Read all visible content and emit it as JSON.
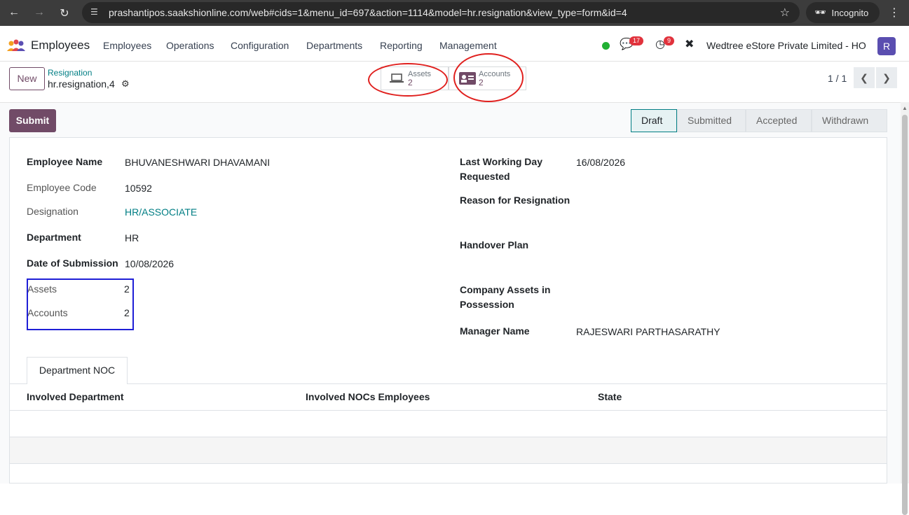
{
  "browser": {
    "url": "prashantipos.saakshionline.com/web#cids=1&menu_id=697&action=1114&model=hr.resignation&view_type=form&id=4",
    "incognito_label": "Incognito"
  },
  "navbar": {
    "app_name": "Employees",
    "menu": [
      "Employees",
      "Operations",
      "Configuration",
      "Departments",
      "Reporting",
      "Management"
    ],
    "messages_badge": "17",
    "activities_badge": "9",
    "company": "Wedtree eStore Private Limited - HO",
    "avatar_letter": "R"
  },
  "control_panel": {
    "new_label": "New",
    "breadcrumb_parent": "Resignation",
    "record_name": "hr.resignation,4",
    "smart_buttons": [
      {
        "label": "Assets",
        "count": "2",
        "icon": "laptop-icon"
      },
      {
        "label": "Accounts",
        "count": "2",
        "icon": "id-card-icon"
      }
    ],
    "pager": "1 / 1"
  },
  "status": {
    "submit_label": "Submit",
    "stages": [
      "Draft",
      "Submitted",
      "Accepted",
      "Withdrawn"
    ],
    "active_stage": "Draft"
  },
  "form": {
    "left": [
      {
        "label": "Employee Name",
        "value": "BHUVANESHWARI DHAVAMANI"
      },
      {
        "label": "Employee Code",
        "value": "10592"
      },
      {
        "label": "Designation",
        "value": "HR/ASSOCIATE"
      },
      {
        "label": "Department",
        "value": "HR"
      },
      {
        "label": "Date of Submission",
        "value": "10/08/2026"
      },
      {
        "label": "Assets",
        "value": "2"
      },
      {
        "label": "Accounts",
        "value": "2"
      }
    ],
    "right": [
      {
        "label": "Last Working Day Requested",
        "value": "16/08/2026"
      },
      {
        "label": "Reason for Resignation",
        "value": ""
      },
      {
        "label": "Handover Plan",
        "value": ""
      },
      {
        "label": "Company Assets in Possession",
        "value": ""
      },
      {
        "label": "Manager Name",
        "value": "RAJESWARI PARTHASARATHY"
      }
    ]
  },
  "notebook": {
    "tab_label": "Department NOC",
    "columns": [
      "Involved Department",
      "Involved NOCs Employees",
      "State"
    ]
  },
  "colors": {
    "primary": "#714b67",
    "link": "#017e84",
    "highlight_circle": "#e0201e",
    "highlight_box": "#1f1fd6"
  }
}
